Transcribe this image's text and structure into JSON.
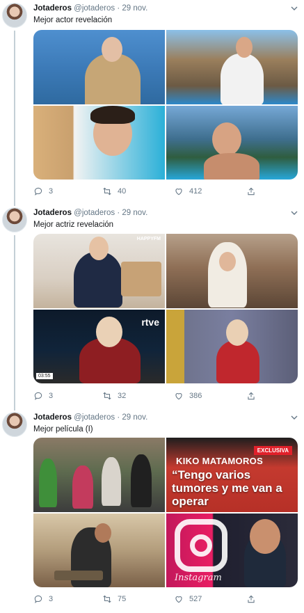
{
  "tweets": [
    {
      "name": "Jotaderos",
      "handle": "@jotaderos",
      "separator": "·",
      "date": "29 nov.",
      "text": "Mejor actor revelación",
      "replies": "3",
      "retweets": "40",
      "likes": "412"
    },
    {
      "name": "Jotaderos",
      "handle": "@jotaderos",
      "separator": "·",
      "date": "29 nov.",
      "text": "Mejor actriz revelación",
      "replies": "3",
      "retweets": "32",
      "likes": "386",
      "media_text": {
        "happy_tag": "HAPPYFM",
        "tv_logo": "rtve",
        "tv_clock": "03:55"
      }
    },
    {
      "name": "Jotaderos",
      "handle": "@jotaderos",
      "separator": "·",
      "date": "29 nov.",
      "text": "Mejor película (I)",
      "replies": "3",
      "retweets": "75",
      "likes": "527",
      "media_text": {
        "exclusive_badge": "EXCLUSIVA",
        "headline_name": "KIKO MATAMOROS",
        "headline": "“Tengo varios tumores y me van a operar",
        "instagram_word": "Instagram"
      }
    }
  ],
  "icons": {
    "reply": "reply-icon",
    "retweet": "retweet-icon",
    "like": "like-icon",
    "share": "share-icon",
    "caret": "chevron-down-icon"
  },
  "colors": {
    "text_primary": "#14171a",
    "text_secondary": "#657786",
    "thread_line": "#c4cfd6"
  }
}
